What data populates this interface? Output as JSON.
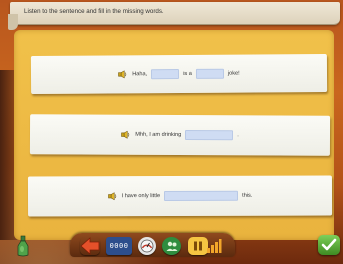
{
  "instruction": "Listen to the sentence and fill in the missing words.",
  "sentences": [
    {
      "parts": [
        "Haha,",
        "is a",
        "joke!"
      ]
    },
    {
      "parts": [
        "Mhh, I am drinking",
        "."
      ]
    },
    {
      "parts": [
        "I have only little",
        "this."
      ]
    }
  ],
  "toolbar": {
    "counter_text": "0000",
    "icons": [
      "left-arrow-icon",
      "counter-icon",
      "gauge-icon",
      "people-icon",
      "pause-icon",
      "levels-icon"
    ]
  },
  "colors": {
    "background": "#c9661e",
    "paper": "#f1c14a",
    "card": "#fbfbf6",
    "blank": "#cfdcf3",
    "check": "#5fb83c"
  }
}
